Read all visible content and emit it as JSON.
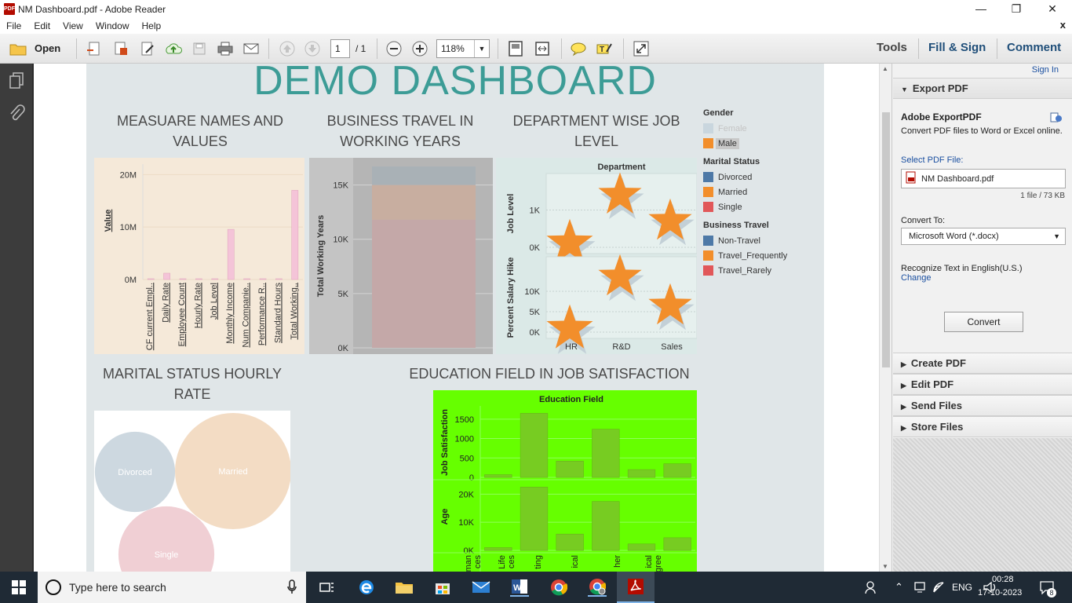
{
  "window": {
    "title": "NM Dashboard.pdf - Adobe Reader",
    "minimize": "—",
    "restore": "❐",
    "close": "✕"
  },
  "menu": {
    "items": [
      "File",
      "Edit",
      "View",
      "Window",
      "Help"
    ],
    "close": "x"
  },
  "toolbar": {
    "open_label": "Open",
    "page_current": "1",
    "page_total": "/ 1",
    "zoom": "118%",
    "tools": "Tools",
    "fill_sign": "Fill & Sign",
    "comment": "Comment"
  },
  "dashboard": {
    "title": "DEMO DASHBOARD",
    "sheets": {
      "measures": "MEASUARE NAMES AND VALUES",
      "travel": "BUSINESS TRAVEL IN WORKING YEARS",
      "department": "DEPARTMENT WISE JOB LEVEL",
      "marital": "MARITAL STATUS HOURLY RATE",
      "education": "EDUCATION FIELD IN JOB SATISFACTION"
    },
    "legend": {
      "gender_title": "Gender",
      "gender": [
        {
          "label": "Female",
          "color": "#c9d6de"
        },
        {
          "label": "Male",
          "color": "#f28e2b"
        }
      ],
      "marital_title": "Marital Status",
      "marital": [
        {
          "label": "Divorced",
          "color": "#4e79a7"
        },
        {
          "label": "Married",
          "color": "#f28e2b"
        },
        {
          "label": "Single",
          "color": "#e15759"
        }
      ],
      "travel_title": "Business Travel",
      "travel": [
        {
          "label": "Non-Travel",
          "color": "#4e79a7"
        },
        {
          "label": "Travel_Frequently",
          "color": "#f28e2b"
        },
        {
          "label": "Travel_Rarely",
          "color": "#e15759"
        }
      ]
    }
  },
  "chart_data": [
    {
      "type": "bar",
      "title": "MEASUARE NAMES AND VALUES",
      "ylabel": "Value",
      "categories": [
        "CF current Empl..",
        "Daily Rate",
        "Employee Count",
        "Hourly Rate",
        "Job Level",
        "Monthly Income",
        "Num Companie..",
        "Performance R..",
        "Standard Hours",
        "Total Working.."
      ],
      "values": [
        0,
        1200000,
        1470,
        96000,
        3000,
        9560000,
        4000,
        4500,
        117600,
        17000000
      ],
      "yticks": [
        "0M",
        "10M",
        "20M"
      ],
      "ylim": [
        0,
        22000000
      ],
      "color": "#f4c4d8"
    },
    {
      "type": "bar",
      "title": "BUSINESS TRAVEL IN WORKING YEARS",
      "ylabel": "Total Working Years",
      "stacked": true,
      "series": [
        {
          "name": "Travel_Rarely",
          "values": [
            11800
          ],
          "color": "#c4a8a8"
        },
        {
          "name": "Travel_Frequently",
          "values": [
            3200
          ],
          "color": "#c8aea0"
        },
        {
          "name": "Non-Travel",
          "values": [
            1700
          ],
          "color": "#a9b1b6"
        }
      ],
      "yticks": [
        "0K",
        "5K",
        "10K",
        "15K"
      ],
      "ylim": [
        0,
        17500
      ]
    },
    {
      "type": "scatter",
      "title": "DEPARTMENT WISE JOB LEVEL",
      "xlabel": "Department",
      "categories": [
        "HR",
        "R&D",
        "Sales"
      ],
      "series": [
        {
          "name": "Job Level",
          "values": [
            110,
            1400,
            700
          ],
          "yticks": [
            "0K",
            "1K"
          ],
          "ylim": [
            0,
            1600
          ]
        },
        {
          "name": "Percent Salary Hike",
          "values": [
            850,
            13500,
            6400
          ],
          "yticks": [
            "0K",
            "5K",
            "10K"
          ],
          "ylim": [
            0,
            15000
          ]
        }
      ],
      "marker": "star",
      "color": "#f28e2b"
    },
    {
      "type": "bubble",
      "title": "MARITAL STATUS HOURLY RATE",
      "categories": [
        "Divorced",
        "Married",
        "Single"
      ],
      "values": [
        21000,
        44000,
        30000
      ],
      "colors": [
        "#cdd8e0",
        "#f3dcc4",
        "#f0cfd4"
      ]
    },
    {
      "type": "bar",
      "title": "EDUCATION FIELD IN JOB SATISFACTION",
      "xlabel": "Education Field",
      "categories": [
        "Human Resources",
        "Life Sciences",
        "Marketing",
        "Medical",
        "Other",
        "Technical Degree"
      ],
      "series": [
        {
          "name": "Job Satisfaction",
          "values": [
            70,
            1650,
            420,
            1240,
            200,
            350
          ],
          "yticks": [
            "0",
            "500",
            "1000",
            "1500"
          ],
          "ylim": [
            0,
            1800
          ]
        },
        {
          "name": "Age",
          "values": [
            1000,
            22500,
            5800,
            17400,
            2300,
            4500
          ],
          "yticks": [
            "0K",
            "10K",
            "20K"
          ],
          "ylim": [
            0,
            24000
          ]
        }
      ],
      "tick_fragments": [
        "man",
        "ces",
        "Life",
        "ces",
        "ting",
        "ical",
        "her",
        "ical",
        "gree"
      ],
      "color": "#77cc22",
      "background": "#66ff00"
    }
  ],
  "right_pane": {
    "sign_in": "Sign In",
    "export_title": "Export PDF",
    "adobe_export": "Adobe ExportPDF",
    "desc": "Convert PDF files to Word or Excel online.",
    "select_label": "Select PDF File:",
    "file_name": "NM Dashboard.pdf",
    "file_info": "1 file / 73 KB",
    "convert_to": "Convert To:",
    "format": "Microsoft Word (*.docx)",
    "recognize": "Recognize Text in English(U.S.)",
    "change": "Change",
    "convert_btn": "Convert",
    "sections": [
      "Create PDF",
      "Edit PDF",
      "Send Files",
      "Store Files"
    ]
  },
  "taskbar": {
    "search_placeholder": "Type here to search",
    "time": "00:28",
    "date": "17-10-2023",
    "lang": "ENG",
    "notif_count": "8"
  }
}
